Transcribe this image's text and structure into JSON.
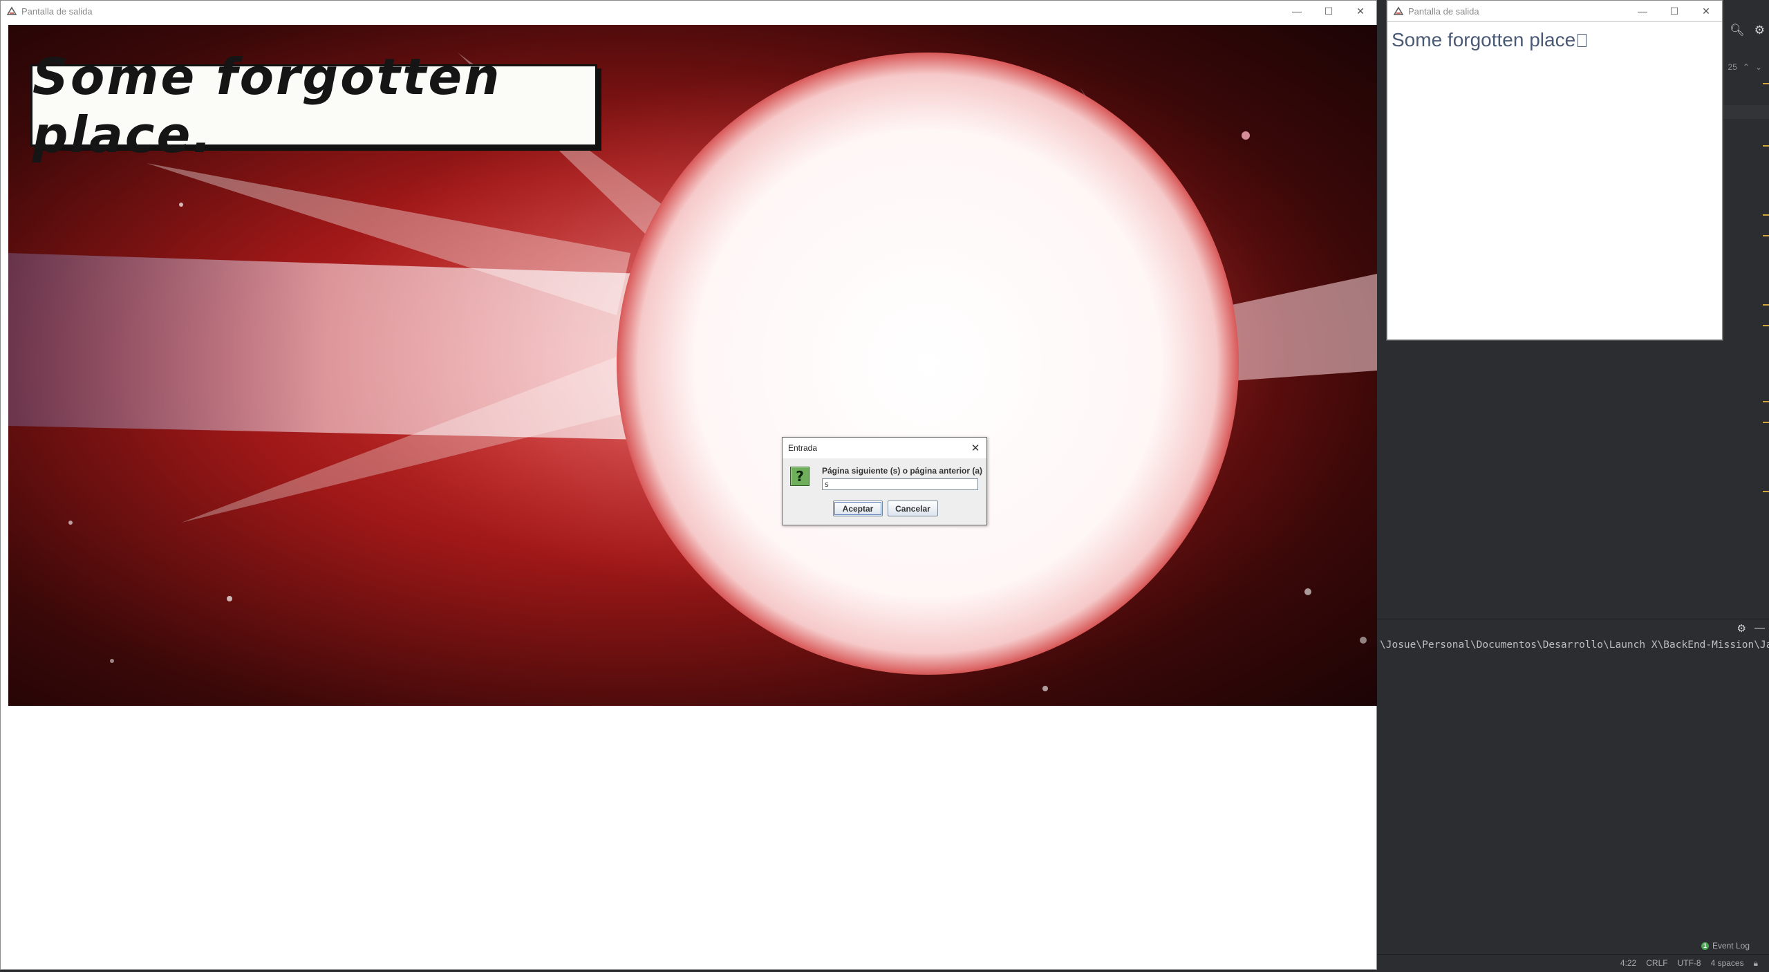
{
  "main_window": {
    "title": "Pantalla de salida"
  },
  "small_window": {
    "title": "Pantalla de salida",
    "text": "Some forgotten place"
  },
  "comic": {
    "caption": "Some forgotten place."
  },
  "dialog": {
    "title": "Entrada",
    "icon": "question-icon",
    "prompt": "Página siguiente (s) o página anterior (a)",
    "input_value": "s",
    "ok_label": "Aceptar",
    "cancel_label": "Cancelar"
  },
  "ide": {
    "line_count_hint": "25",
    "terminal_path": "\\Josue\\Personal\\Documentos\\Desarrollo\\Launch X\\BackEnd-Mission\\Java\\pr",
    "event_log_label": "Event Log",
    "status": {
      "position": "4:22",
      "line_ending": "CRLF",
      "encoding": "UTF-8",
      "indent": "4 spaces"
    }
  },
  "colors": {
    "accent_red": "#c81e1e",
    "ide_bg": "#2b2d30",
    "question_icon_green": "#6fae5b"
  }
}
